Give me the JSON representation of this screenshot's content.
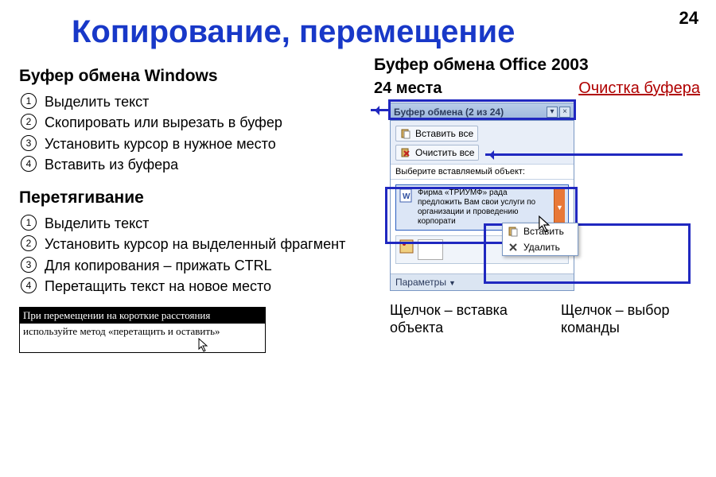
{
  "page_number": "24",
  "title": "Копирование, перемещение",
  "left": {
    "heading1": "Буфер обмена Windows",
    "list1": [
      "Выделить текст",
      "Скопировать или вырезать в буфер",
      "Установить курсор в нужное место",
      "Вставить из буфера"
    ],
    "heading2": "Перетягивание",
    "list2": [
      "Выделить текст",
      "Установить курсор на выделенный фрагмент",
      "Для копирования – прижать CTRL",
      "Перетащить текст на новое место"
    ],
    "hint_hdr": "При перемещении на короткие расстояния",
    "hint_body": "используйте метод «перетащить и оставить»"
  },
  "right": {
    "heading": "Буфер обмена Office 2003",
    "info_left": "24 места",
    "info_right": "Очистка буфера",
    "panel": {
      "title": "Буфер обмена (2 из 24)",
      "btn_paste_all": "Вставить все",
      "btn_clear_all": "Очистить все",
      "instruction": "Выберите вставляемый объект:",
      "item_text": "Фирма «ТРИУМФ» рада предложить Вам свои услуги по организации и проведению корпорати",
      "ctx_paste": "Вставить",
      "ctx_delete": "Удалить",
      "footer": "Параметры"
    },
    "caption1": "Щелчок – вставка объекта",
    "caption2": "Щелчок – выбор команды"
  },
  "colors": {
    "title_blue": "#1838c8",
    "highlight_blue": "#2028c0",
    "link_red": "#b00000"
  }
}
